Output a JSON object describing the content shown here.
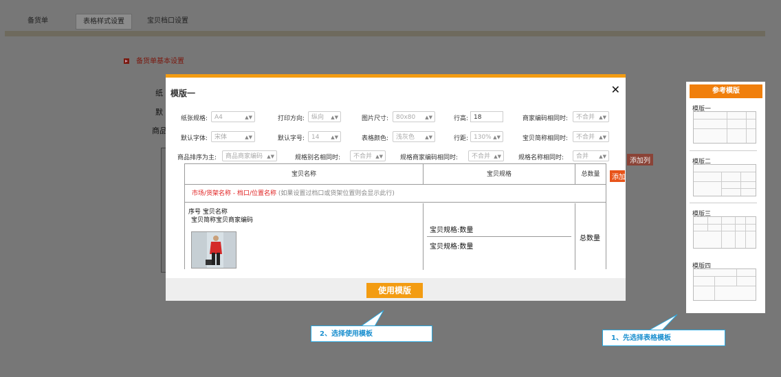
{
  "tabs": [
    {
      "label": "备货单",
      "active": false
    },
    {
      "label": "表格样式设置",
      "active": true
    },
    {
      "label": "宝贝档口设置",
      "active": false
    }
  ],
  "background": {
    "section_title": "备货单基本设置",
    "labels": [
      "纸",
      "默",
      "商品"
    ],
    "add_column": "添加列"
  },
  "modal": {
    "title": "模版一",
    "close_icon": "close-icon",
    "fields": {
      "paper_size": {
        "label": "纸张规格:",
        "value": "A4"
      },
      "print_direction": {
        "label": "打印方向:",
        "value": "纵向"
      },
      "image_size": {
        "label": "图片尺寸:",
        "value": "80x80"
      },
      "row_height": {
        "label": "行高:",
        "value": "18"
      },
      "merchant_code_same": {
        "label": "商家编码相同时:",
        "value": "不合并"
      },
      "default_font": {
        "label": "默认字体:",
        "value": "宋体"
      },
      "default_font_size": {
        "label": "默认字号:",
        "value": "14"
      },
      "table_color": {
        "label": "表格颜色:",
        "value": "浅灰色"
      },
      "row_spacing": {
        "label": "行距:",
        "value": "130%"
      },
      "short_name_same": {
        "label": "宝贝简称相同时:",
        "value": "不合并"
      },
      "sort_by": {
        "label": "商品排序为主:",
        "value": "商品商家编码"
      },
      "spec_alias_same": {
        "label": "规格别名相同时:",
        "value": "不合并"
      },
      "spec_merchant_code_same": {
        "label": "规格商家编码相同时:",
        "value": "不合并"
      },
      "spec_name_same": {
        "label": "规格名称相同时:",
        "value": "合并"
      }
    },
    "preview": {
      "headers": [
        "宝贝名称",
        "宝贝规格",
        "总数量"
      ],
      "market_red": "市场/货架名称 - 档口/位置名称",
      "market_note": "(如果设置过档口或货架位置则会显示此行)",
      "item_line1": "序号 宝贝名称",
      "item_line2": "宝贝简称宝贝商家编码",
      "spec_rows": [
        "宝贝规格:数量",
        "宝贝规格:数量"
      ],
      "total": "总数量",
      "add_column": "添加列"
    },
    "use_button": "使用模版"
  },
  "template_panel": {
    "title": "参考模版",
    "templates": [
      "模版一",
      "模版二",
      "模版三",
      "模版四"
    ]
  },
  "callouts": {
    "step2": "2、选择使用模板",
    "step1": "1、先选择表格模板"
  },
  "colors": {
    "accent": "#f39c12",
    "panel_header": "#f07f0c",
    "callout_border": "#29a8e0",
    "highlight_red": "#e02020"
  }
}
